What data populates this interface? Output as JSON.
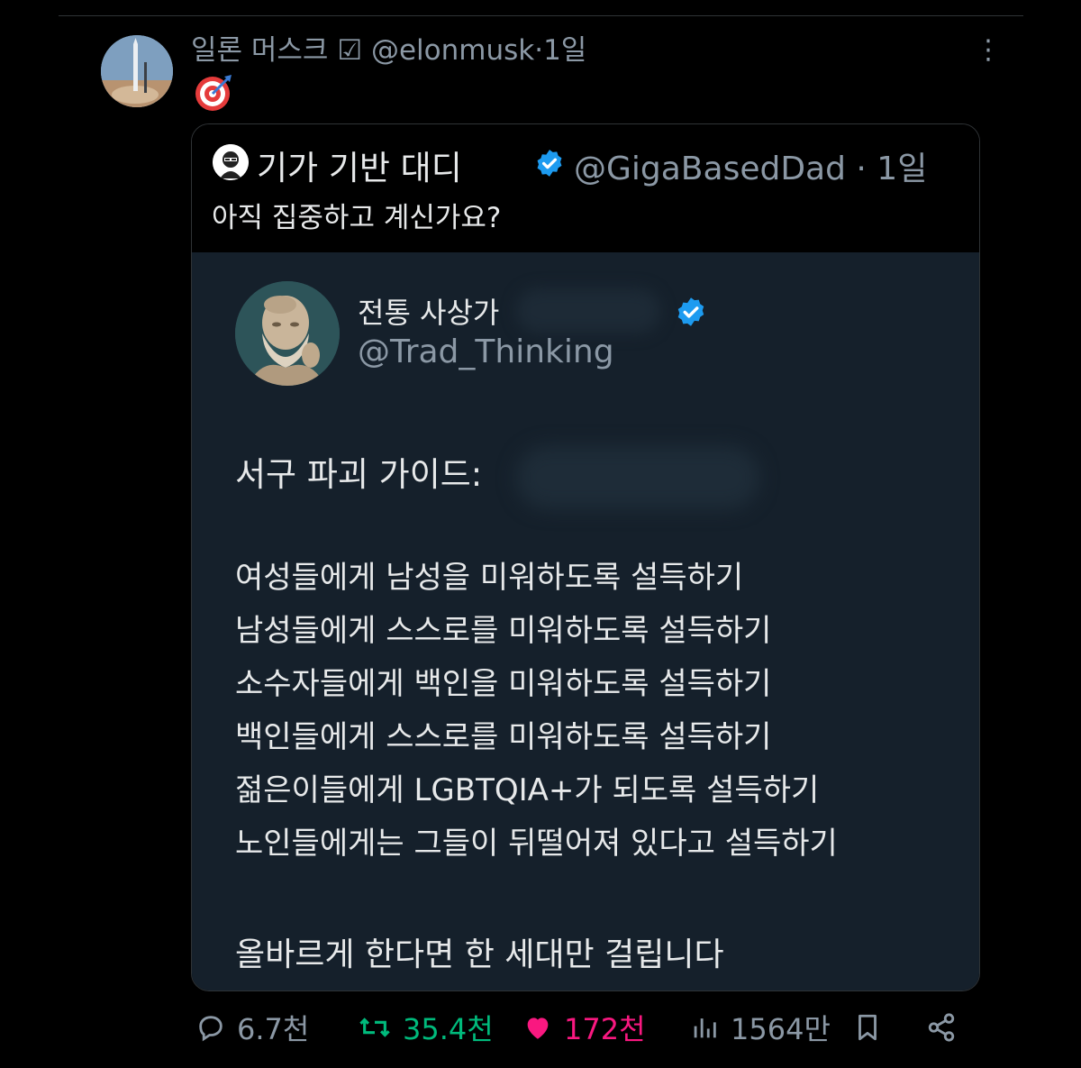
{
  "colors": {
    "background": "#000000",
    "text": "#e7e9ea",
    "muted": "#8b98a5",
    "verified_blue": "#1d9bf0",
    "retweet_green": "#00ba7c",
    "like_pink": "#f91880",
    "embedded_image_bg": "#15202b"
  },
  "tweet": {
    "author_name": "일론 머스크",
    "verified_mark": "☑",
    "handle": "@elonmusk",
    "time": "·1일",
    "more_icon": "⋮",
    "emoji_icon": "direct-hit-icon"
  },
  "quoted": {
    "author_name": "기가 기반 대디",
    "handle": "@GigaBasedDad · 1일",
    "text": "아직 집중하고 계신가요?",
    "image": {
      "author_name": "전통 사상가",
      "handle": "@Trad_Thinking",
      "title": "서구 파괴 가이드:",
      "lines": [
        "여성들에게 남성을 미워하도록 설득하기",
        "남성들에게 스스로를 미워하도록 설득하기",
        "소수자들에게 백인을 미워하도록 설득하기",
        "백인들에게 스스로를 미워하도록 설득하기",
        "젊은이들에게 LGBTQIA+가 되도록 설득하기",
        "노인들에게는 그들이 뒤떨어져 있다고 설득하기"
      ],
      "footer": "올바르게 한다면 한 세대만 걸립니다"
    }
  },
  "actions": {
    "replies": "6.7천",
    "retweets": "35.4천",
    "likes": "172천",
    "views": "1564만"
  }
}
